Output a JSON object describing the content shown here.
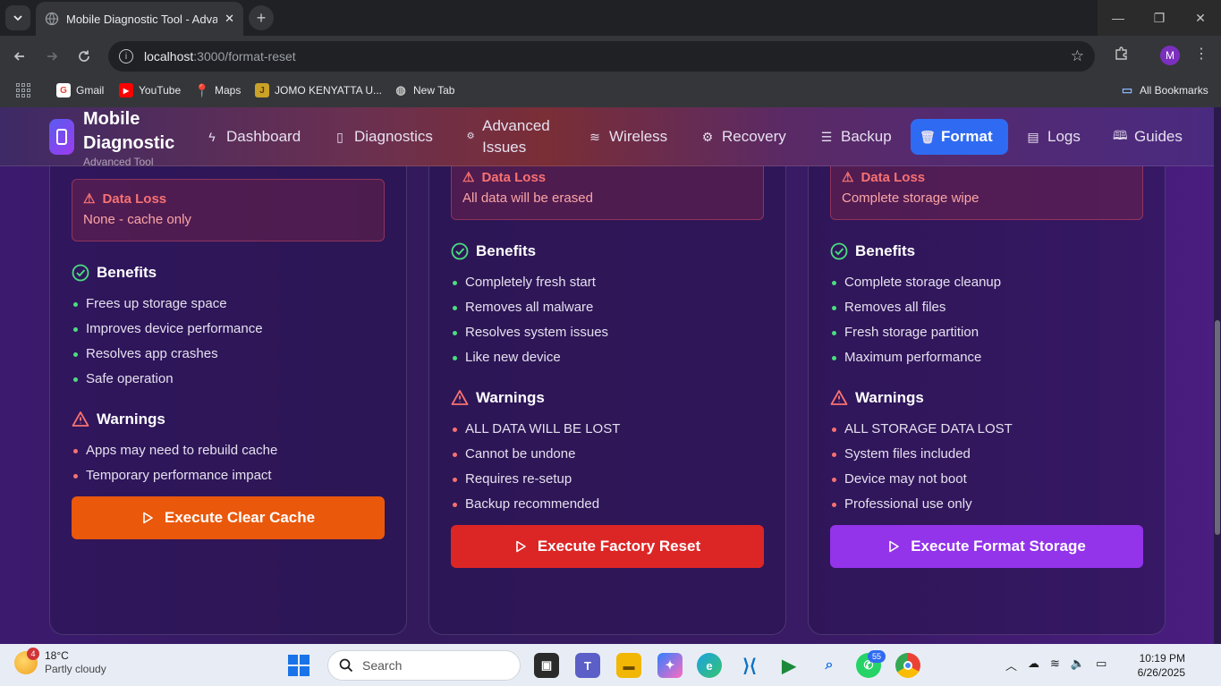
{
  "browser": {
    "tab_title": "Mobile Diagnostic Tool - Advan",
    "url_host": "localhost",
    "url_path": ":3000/format-reset",
    "profile_initial": "M",
    "bookmarks": [
      {
        "label": "Gmail",
        "icon": "gmail-icon"
      },
      {
        "label": "YouTube",
        "icon": "youtube-icon"
      },
      {
        "label": "Maps",
        "icon": "maps-icon"
      },
      {
        "label": "JOMO KENYATTA U...",
        "icon": "university-icon"
      },
      {
        "label": "New Tab",
        "icon": "globe-icon"
      }
    ],
    "all_bookmarks": "All Bookmarks"
  },
  "app": {
    "brand_title": "Mobile Diagnostic",
    "brand_subtitle": "Advanced Tool",
    "nav": [
      {
        "label": "Dashboard",
        "icon": "lightning-icon"
      },
      {
        "label": "Diagnostics",
        "icon": "phone-icon"
      },
      {
        "label": "Advanced Issues",
        "icon": "gear-icon"
      },
      {
        "label": "Wireless",
        "icon": "wifi-icon"
      },
      {
        "label": "Recovery",
        "icon": "gear-icon"
      },
      {
        "label": "Backup",
        "icon": "database-icon"
      },
      {
        "label": "Format",
        "icon": "trash-icon",
        "active": true
      },
      {
        "label": "Logs",
        "icon": "file-icon"
      },
      {
        "label": "Guides",
        "icon": "book-icon"
      }
    ]
  },
  "cards": [
    {
      "accent": "#f97316",
      "data_loss_label": "Data Loss",
      "data_loss_value": "None - cache only",
      "benefits_title": "Benefits",
      "benefits": [
        "Frees up storage space",
        "Improves device performance",
        "Resolves app crashes",
        "Safe operation"
      ],
      "warnings_title": "Warnings",
      "warnings": [
        "Apps may need to rebuild cache",
        "Temporary performance impact"
      ],
      "button_label": "Execute Clear Cache",
      "button_color": "#ea580c"
    },
    {
      "accent": "#ef4444",
      "data_loss_label": "Data Loss",
      "data_loss_value": "All data will be erased",
      "benefits_title": "Benefits",
      "benefits": [
        "Completely fresh start",
        "Removes all malware",
        "Resolves system issues",
        "Like new device"
      ],
      "warnings_title": "Warnings",
      "warnings": [
        "ALL DATA WILL BE LOST",
        "Cannot be undone",
        "Requires re-setup",
        "Backup recommended"
      ],
      "button_label": "Execute Factory Reset",
      "button_color": "#dc2626"
    },
    {
      "accent": "#a855f7",
      "data_loss_label": "Data Loss",
      "data_loss_value": "Complete storage wipe",
      "benefits_title": "Benefits",
      "benefits": [
        "Complete storage cleanup",
        "Removes all files",
        "Fresh storage partition",
        "Maximum performance"
      ],
      "warnings_title": "Warnings",
      "warnings": [
        "ALL STORAGE DATA LOST",
        "System files included",
        "Device may not boot",
        "Professional use only"
      ],
      "button_label": "Execute Format Storage",
      "button_color": "#9333ea"
    }
  ],
  "taskbar": {
    "weather_badge": "4",
    "weather_temp": "18°C",
    "weather_desc": "Partly cloudy",
    "search_placeholder": "Search",
    "whatsapp_badge": "55",
    "time": "10:19 PM",
    "date": "6/26/2025"
  }
}
